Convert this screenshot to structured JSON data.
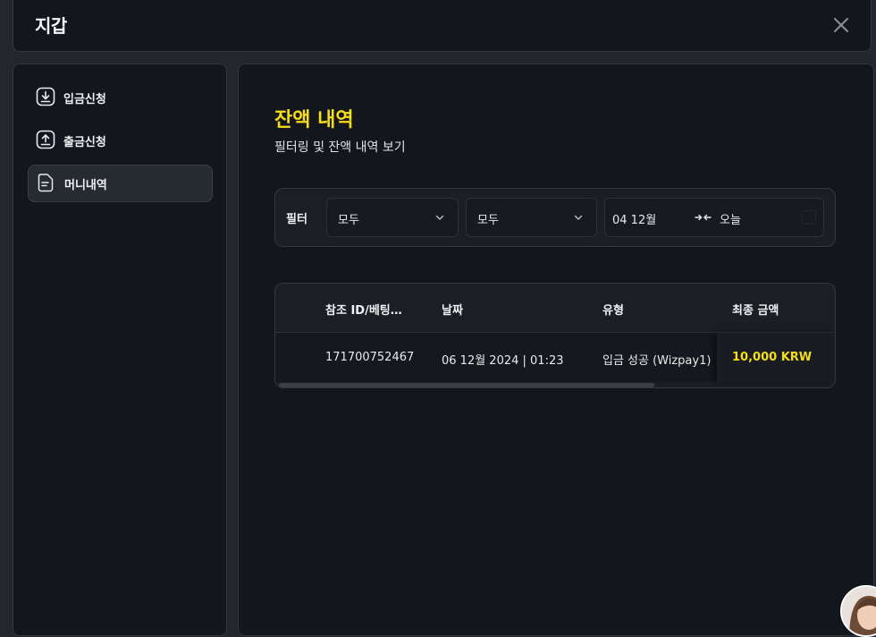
{
  "header": {
    "title": "지갑",
    "close_icon": "close-icon"
  },
  "sidebar": {
    "items": [
      {
        "label": "입금신청",
        "icon": "download-icon",
        "active": false
      },
      {
        "label": "출금신청",
        "icon": "upload-icon",
        "active": false
      },
      {
        "label": "머니내역",
        "icon": "document-icon",
        "active": true
      }
    ]
  },
  "main": {
    "title": "잔액 내역",
    "subtitle": "필터링 및 잔액 내역 보기",
    "filter": {
      "label": "필터",
      "select1": "모두",
      "select2": "모두",
      "date_start": "04 12월",
      "date_end": "오늘"
    },
    "table": {
      "columns": [
        "참조 ID/베팅…",
        "날짜",
        "유형",
        "최종 금액"
      ],
      "rows": [
        [
          "171700752467",
          "06 12월 2024 | 01:23",
          "입금 성공 (Wizpay1)",
          "10,000 KRW"
        ]
      ]
    }
  },
  "colors": {
    "accent": "#f4dd1b",
    "panel": "#13161c",
    "border": "#34373f"
  }
}
